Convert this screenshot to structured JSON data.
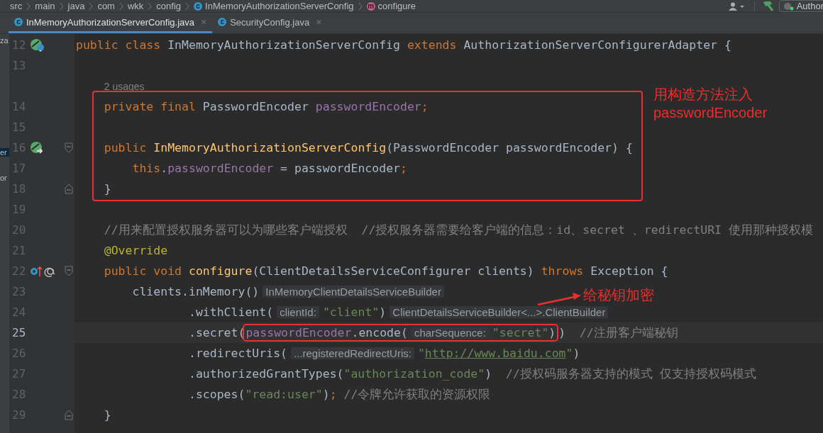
{
  "breadcrumbs": [
    {
      "label": "src"
    },
    {
      "label": "main"
    },
    {
      "label": "java"
    },
    {
      "label": "com"
    },
    {
      "label": "wkk"
    },
    {
      "label": "config"
    },
    {
      "label": "InMemoryAuthorizationServerConfig",
      "kind": "class",
      "icon_letter": "c"
    },
    {
      "label": "configure",
      "kind": "method",
      "icon_letter": "m"
    }
  ],
  "toolbar": {
    "run_config": "Author"
  },
  "tabs": [
    {
      "label": "InMemoryAuthorizationServerConfig.java",
      "icon_letter": "c",
      "close": "×",
      "selected": true
    },
    {
      "label": "SecurityConfig.java",
      "icon_letter": "c",
      "close": "×",
      "selected": false
    }
  ],
  "project_panel": [
    {
      "label": "za",
      "selected": false
    },
    {
      "label": "er",
      "selected": true
    },
    {
      "label": "or",
      "selected": false
    }
  ],
  "editor": {
    "rows": [
      {
        "kind": "code",
        "number": "12",
        "marker": {
          "kind": "class"
        },
        "tokens": [
          {
            "kind": "kw",
            "text": "public class "
          },
          {
            "kind": "plain",
            "text": "InMemoryAuthorizationServerConfig "
          },
          {
            "kind": "kw",
            "text": "extends "
          },
          {
            "kind": "plain",
            "text": "AuthorizationServerConfigurerAdapter {"
          }
        ]
      },
      {
        "kind": "code",
        "number": "13",
        "tokens": []
      },
      {
        "kind": "usages",
        "indent": "    ",
        "text": "2 usages"
      },
      {
        "kind": "code",
        "number": "14",
        "indent": "    ",
        "tokens": [
          {
            "kind": "kw",
            "text": "private final "
          },
          {
            "kind": "plain",
            "text": "PasswordEncoder "
          },
          {
            "kind": "field",
            "text": "passwordEncoder"
          },
          {
            "kind": "kw",
            "text": ";"
          }
        ]
      },
      {
        "kind": "code",
        "number": "15",
        "tokens": []
      },
      {
        "kind": "code",
        "number": "16",
        "marker": {
          "kind": "constructor"
        },
        "fold": {
          "kind": "open"
        },
        "indent": "    ",
        "tokens": [
          {
            "kind": "kw",
            "text": "public "
          },
          {
            "kind": "decl",
            "text": "InMemoryAuthorizationServerConfig"
          },
          {
            "kind": "plain",
            "text": "(PasswordEncoder passwordEncoder) {"
          }
        ]
      },
      {
        "kind": "code",
        "number": "17",
        "indent": "        ",
        "tokens": [
          {
            "kind": "kw",
            "text": "this"
          },
          {
            "kind": "plain",
            "text": "."
          },
          {
            "kind": "field",
            "text": "passwordEncoder"
          },
          {
            "kind": "plain",
            "text": " = passwordEncoder"
          },
          {
            "kind": "kw",
            "text": ";"
          }
        ]
      },
      {
        "kind": "code",
        "number": "18",
        "fold": {
          "kind": "close"
        },
        "indent": "    ",
        "tokens": [
          {
            "kind": "plain",
            "text": "}"
          }
        ]
      },
      {
        "kind": "code",
        "number": "19",
        "tokens": []
      },
      {
        "kind": "code",
        "number": "20",
        "indent": "    ",
        "tokens": [
          {
            "kind": "comment",
            "text": "//用来配置授权服务器可以为哪些客户端授权  //授权服务器需要给客户端的信息：id、secret 、redirectURI 使用那种授权模"
          }
        ]
      },
      {
        "kind": "code",
        "number": "21",
        "indent": "    ",
        "tokens": [
          {
            "kind": "annotation",
            "text": "@Override"
          }
        ]
      },
      {
        "kind": "code",
        "number": "22",
        "marker": {
          "kind": "override"
        },
        "fold": {
          "kind": "open"
        },
        "indent": "    ",
        "tokens": [
          {
            "kind": "kw",
            "text": "public void "
          },
          {
            "kind": "decl",
            "text": "configure"
          },
          {
            "kind": "plain",
            "text": "(ClientDetailsServiceConfigurer clients) "
          },
          {
            "kind": "kw",
            "text": "throws "
          },
          {
            "kind": "plain",
            "text": "Exception {"
          }
        ]
      },
      {
        "kind": "code",
        "number": "23",
        "indent": "        ",
        "tokens": [
          {
            "kind": "plain",
            "text": "clients.inMemory()"
          },
          {
            "kind": "hint",
            "text": "InMemoryClientDetailsServiceBuilder"
          }
        ]
      },
      {
        "kind": "code",
        "number": "24",
        "indent": "                ",
        "tokens": [
          {
            "kind": "plain",
            "text": ".withClient("
          },
          {
            "kind": "hint",
            "text": "clientId:"
          },
          {
            "kind": "string",
            "text": "\"client\""
          },
          {
            "kind": "plain",
            "text": ")"
          },
          {
            "kind": "hint",
            "text": "ClientDetailsServiceBuilder<...>.ClientBuilder"
          }
        ]
      },
      {
        "kind": "code",
        "number": "25",
        "current": true,
        "indent": "                ",
        "tokens": [
          {
            "kind": "plain",
            "text": ".secret("
          },
          {
            "kind": "field",
            "text": "passwordEncoder",
            "boxed": true
          },
          {
            "kind": "plain",
            "text": ".encode(",
            "boxed": true
          },
          {
            "kind": "hint",
            "text": "charSequence:",
            "boxed": true
          },
          {
            "kind": "string",
            "text": "\"secret\"",
            "boxed": true
          },
          {
            "kind": "plain",
            "text": ")",
            "boxed": true
          },
          {
            "kind": "plain",
            "text": ")  "
          },
          {
            "kind": "comment",
            "text": "//注册客户端秘钥"
          }
        ]
      },
      {
        "kind": "code",
        "number": "26",
        "indent": "                ",
        "tokens": [
          {
            "kind": "plain",
            "text": ".redirectUris("
          },
          {
            "kind": "hint",
            "text": "...registeredRedirectUris:"
          },
          {
            "kind": "string",
            "text": "\""
          },
          {
            "kind": "link",
            "text": "http://www.baidu.com"
          },
          {
            "kind": "string",
            "text": "\""
          },
          {
            "kind": "plain",
            "text": ")"
          }
        ]
      },
      {
        "kind": "code",
        "number": "27",
        "indent": "                ",
        "tokens": [
          {
            "kind": "plain",
            "text": ".authorizedGrantTypes("
          },
          {
            "kind": "string",
            "text": "\"authorization_code\""
          },
          {
            "kind": "plain",
            "text": ")  "
          },
          {
            "kind": "comment",
            "text": "//授权码服务器支持的模式 仅支持授权码模式"
          }
        ]
      },
      {
        "kind": "code",
        "number": "28",
        "indent": "                ",
        "tokens": [
          {
            "kind": "plain",
            "text": ".scopes("
          },
          {
            "kind": "string",
            "text": "\"read:user\""
          },
          {
            "kind": "plain",
            "text": ")"
          },
          {
            "kind": "kw",
            "text": "; "
          },
          {
            "kind": "comment",
            "text": "//令牌允许获取的资源权限"
          }
        ]
      },
      {
        "kind": "code",
        "number": "29",
        "fold": {
          "kind": "close"
        },
        "indent": "    ",
        "tokens": [
          {
            "kind": "plain",
            "text": "}"
          }
        ]
      }
    ]
  },
  "callouts": [
    {
      "lines": [
        "用构造方法注入",
        "passwordEncoder"
      ]
    },
    {
      "lines": [
        "给秘钥加密"
      ]
    }
  ]
}
